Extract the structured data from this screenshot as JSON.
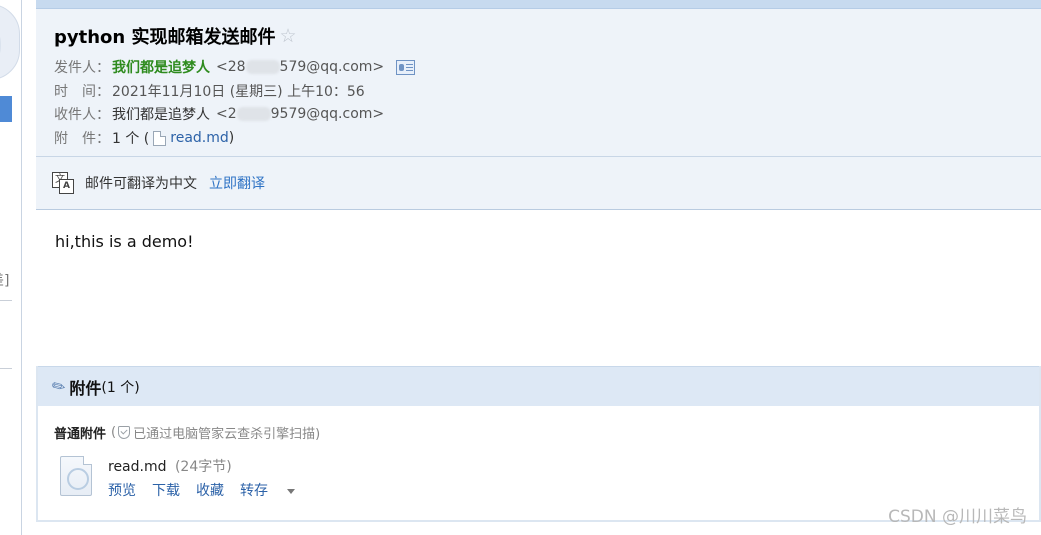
{
  "mail": {
    "subject": "python 实现邮箱发送邮件",
    "sender_label": "发件人：",
    "sender_name": "我们都是追梦人",
    "sender_addr_prefix": "<28",
    "sender_addr_suffix": "579@qq.com>",
    "time_label": "时　间：",
    "time_value": "2021年11月10日 (星期三) 上午10：56",
    "recipient_label": "收件人：",
    "recipient_name": "我们都是追梦人",
    "recipient_addr_prefix": "<2",
    "recipient_addr_suffix": "9579@qq.com>",
    "attach_label": "附　件：",
    "attach_count_prefix": "1 个 (",
    "attach_file": "read.md",
    "attach_count_suffix": ")",
    "body": "hi,this is a demo!"
  },
  "translate": {
    "text": "邮件可翻译为中文",
    "link": "立即翻译",
    "icon_a": "文",
    "icon_b": "A"
  },
  "attachments": {
    "title": "附件",
    "count": "(1 个)",
    "normal_title": "普通附件",
    "scan_open": "(",
    "scan_note": "已通过电脑管家云查杀引擎扫描)",
    "file_name": "read.md",
    "file_size": "(24字节)",
    "actions": {
      "preview": "预览",
      "download": "下载",
      "favorite": "收藏",
      "save_to": "转存"
    }
  },
  "left": {
    "bracket": "差]"
  },
  "watermark": "CSDN @川川菜鸟",
  "icons": {
    "star": "star-icon",
    "contact_card": "contact-card-icon",
    "file": "file-icon",
    "translate": "translate-icon",
    "paperclip": "paperclip-icon",
    "shield": "shield-check-icon"
  }
}
